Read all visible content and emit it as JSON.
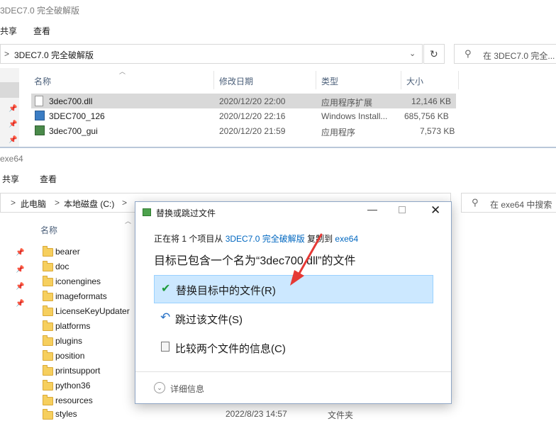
{
  "top_window": {
    "title": "3DEC7.0 完全破解版",
    "ribbon": [
      "共享",
      "查看"
    ],
    "address": {
      "chevron": ">",
      "path": "3DEC7.0 完全破解版"
    },
    "search_placeholder": "在 3DEC7.0 完全...",
    "columns": [
      "名称",
      "修改日期",
      "类型",
      "大小"
    ],
    "files": [
      {
        "name": "3dec700.dll",
        "date": "2020/12/20 22:00",
        "type": "应用程序扩展",
        "size": "12,146 KB"
      },
      {
        "name": "3DEC700_126",
        "date": "2020/12/20 22:16",
        "type": "Windows Install...",
        "size": "685,756 KB"
      },
      {
        "name": "3dec700_gui",
        "date": "2020/12/20 21:59",
        "type": "应用程序",
        "size": "7,573 KB"
      }
    ]
  },
  "bottom_window": {
    "title": "exe64",
    "ribbon": [
      "共享",
      "查看"
    ],
    "address": [
      "此电脑",
      "本地磁盘 (C:)"
    ],
    "search_placeholder": "在 exe64 中搜索",
    "column_name": "名称",
    "folders": [
      "bearer",
      "doc",
      "iconengines",
      "imageformats",
      "LicenseKeyUpdater",
      "platforms",
      "plugins",
      "position",
      "printsupport",
      "python36",
      "resources",
      "styles"
    ],
    "last_row_date": "2022/8/23 14:57",
    "last_row_type": "文件夹"
  },
  "dialog": {
    "title": "替换或跳过文件",
    "info_prefix": "正在将 1 个项目从",
    "info_source": "3DEC7.0 完全破解版",
    "info_mid": "复制到",
    "info_dest": "exe64",
    "heading": "目标已包含一个名为“3dec700.dll”的文件",
    "options": [
      {
        "label": "替换目标中的文件(R)",
        "icon": "checkmark-icon"
      },
      {
        "label": "跳过该文件(S)",
        "icon": "skip-arrow-icon"
      },
      {
        "label": "比较两个文件的信息(C)",
        "icon": "compare-icon"
      }
    ],
    "details": "详细信息",
    "accent": "#0067c0",
    "highlight": "#cce8ff"
  }
}
